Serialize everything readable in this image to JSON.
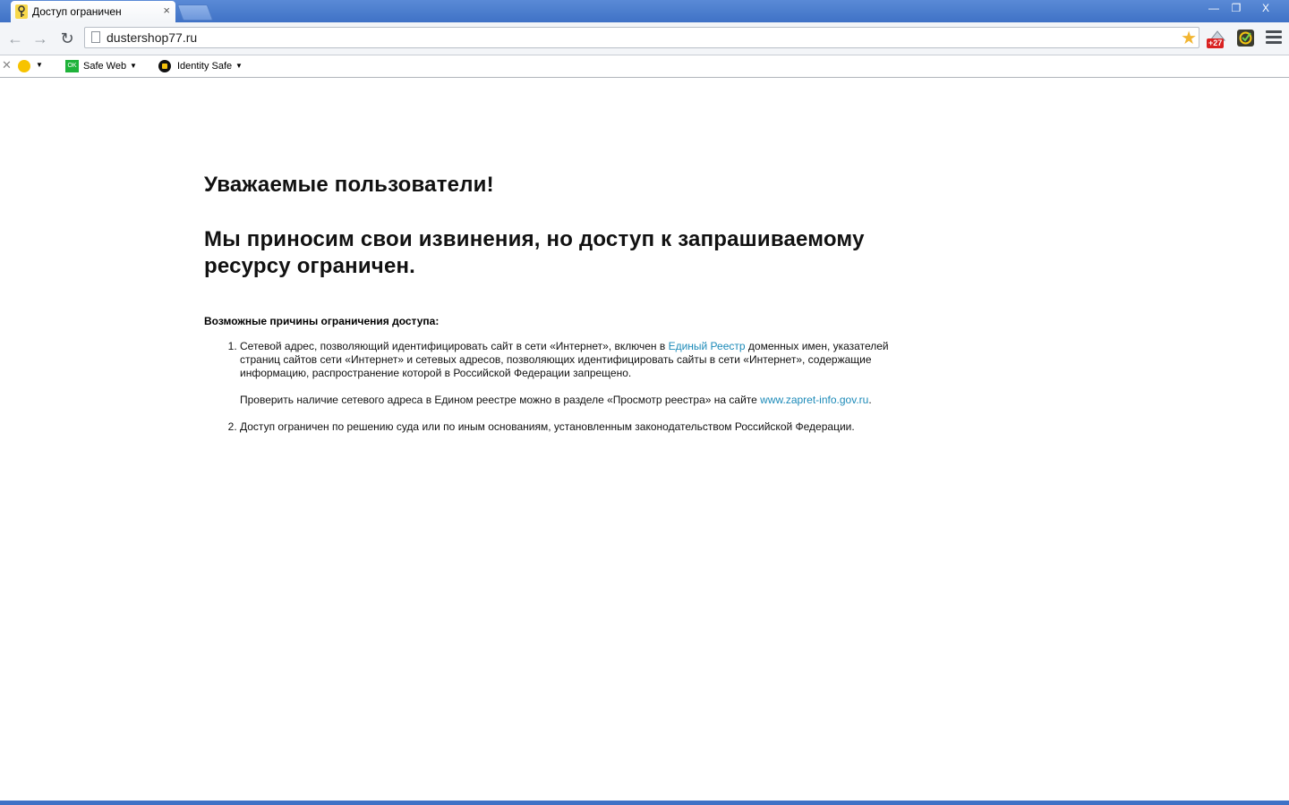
{
  "window": {
    "tab_title": "Доступ ограничен",
    "tab_close": "×",
    "controls": {
      "minimize": "—",
      "maximize": "❐",
      "close": "X"
    }
  },
  "toolbar": {
    "back": "←",
    "forward": "→",
    "reload": "↻",
    "url": "dustershop77.ru",
    "star": "★",
    "extension_badge": "+27"
  },
  "norton_bar": {
    "close": "✕",
    "safe_web_icon_text": "OK",
    "safe_web_label": "Safe Web",
    "identity_safe_label": "Identity Safe",
    "caret": "▼"
  },
  "page": {
    "greeting": "Уважаемые пользователи!",
    "apology": "Мы приносим свои извинения, но доступ к запрашиваемому ресурсу ограничен.",
    "reasons_heading": "Возможные причины ограничения доступа:",
    "reason1": {
      "text_before_link": "Сетевой адрес, позволяющий идентифицировать сайт в сети «Интернет», включен в ",
      "link": "Единый Реестр",
      "text_after_link": " доменных имен, указателей страниц сайтов сети «Интернет» и сетевых адресов, позволяющих идентифицировать сайты в сети «Интернет», содержащие информацию, распространение которой в Российской Федерации запрещено.",
      "check_before_link": "Проверить наличие сетевого адреса в Едином реестре можно в разделе «Просмотр реестра» на сайте ",
      "check_link": "www.zapret-info.gov.ru",
      "check_after_link": "."
    },
    "reason2": "Доступ ограничен  по решению суда или по иным основаниям, установленным законодательством Российской Федерации."
  },
  "colors": {
    "titlebar": "#3f72c6",
    "link": "#1c8ab8",
    "badge": "#d92222",
    "star": "#f2b531",
    "safe_web_green": "#1fb33a"
  }
}
